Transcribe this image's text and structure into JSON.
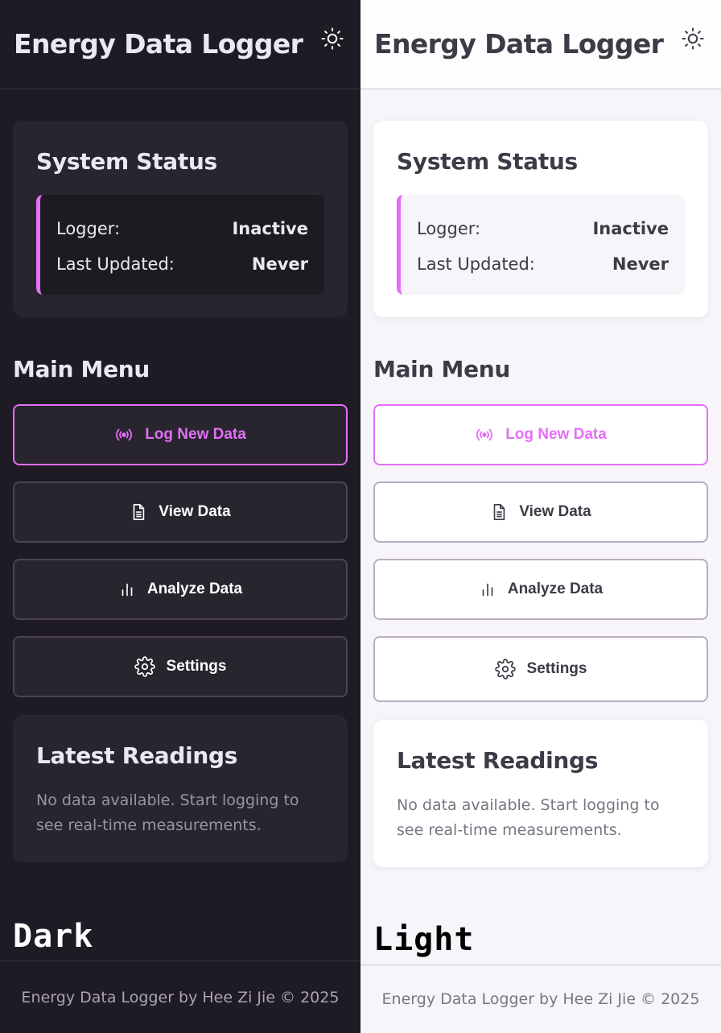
{
  "colors": {
    "accent": "#e36ff7",
    "dark_bg": "#1f1b24",
    "light_bg": "#f7f5f9"
  },
  "dark": {
    "app_title": "Energy Data Logger",
    "theme_icon": "sun-icon",
    "status": {
      "title": "System Status",
      "rows": [
        {
          "label": "Logger:",
          "value": "Inactive"
        },
        {
          "label": "Last Updated:",
          "value": "Never"
        }
      ]
    },
    "menu": {
      "title": "Main Menu",
      "items": [
        {
          "label": "Log New Data",
          "icon": "broadcast-icon"
        },
        {
          "label": "View Data",
          "icon": "document-icon"
        },
        {
          "label": "Analyze Data",
          "icon": "bar-chart-icon"
        },
        {
          "label": "Settings",
          "icon": "gear-icon"
        }
      ]
    },
    "readings": {
      "title": "Latest Readings",
      "text": "No data available. Start logging to see real-time measurements."
    },
    "mode_label": "Dark",
    "footer": "Energy Data Logger by Hee Zi Jie © 2025"
  },
  "light": {
    "app_title": "Energy Data Logger",
    "theme_icon": "sun-icon",
    "status": {
      "title": "System Status",
      "rows": [
        {
          "label": "Logger:",
          "value": "Inactive"
        },
        {
          "label": "Last Updated:",
          "value": "Never"
        }
      ]
    },
    "menu": {
      "title": "Main Menu",
      "items": [
        {
          "label": "Log New Data",
          "icon": "broadcast-icon"
        },
        {
          "label": "View Data",
          "icon": "document-icon"
        },
        {
          "label": "Analyze Data",
          "icon": "bar-chart-icon"
        },
        {
          "label": "Settings",
          "icon": "gear-icon"
        }
      ]
    },
    "readings": {
      "title": "Latest Readings",
      "text": "No data available. Start logging to see real-time measurements."
    },
    "mode_label": "Light",
    "footer": "Energy Data Logger by Hee Zi Jie © 2025"
  }
}
